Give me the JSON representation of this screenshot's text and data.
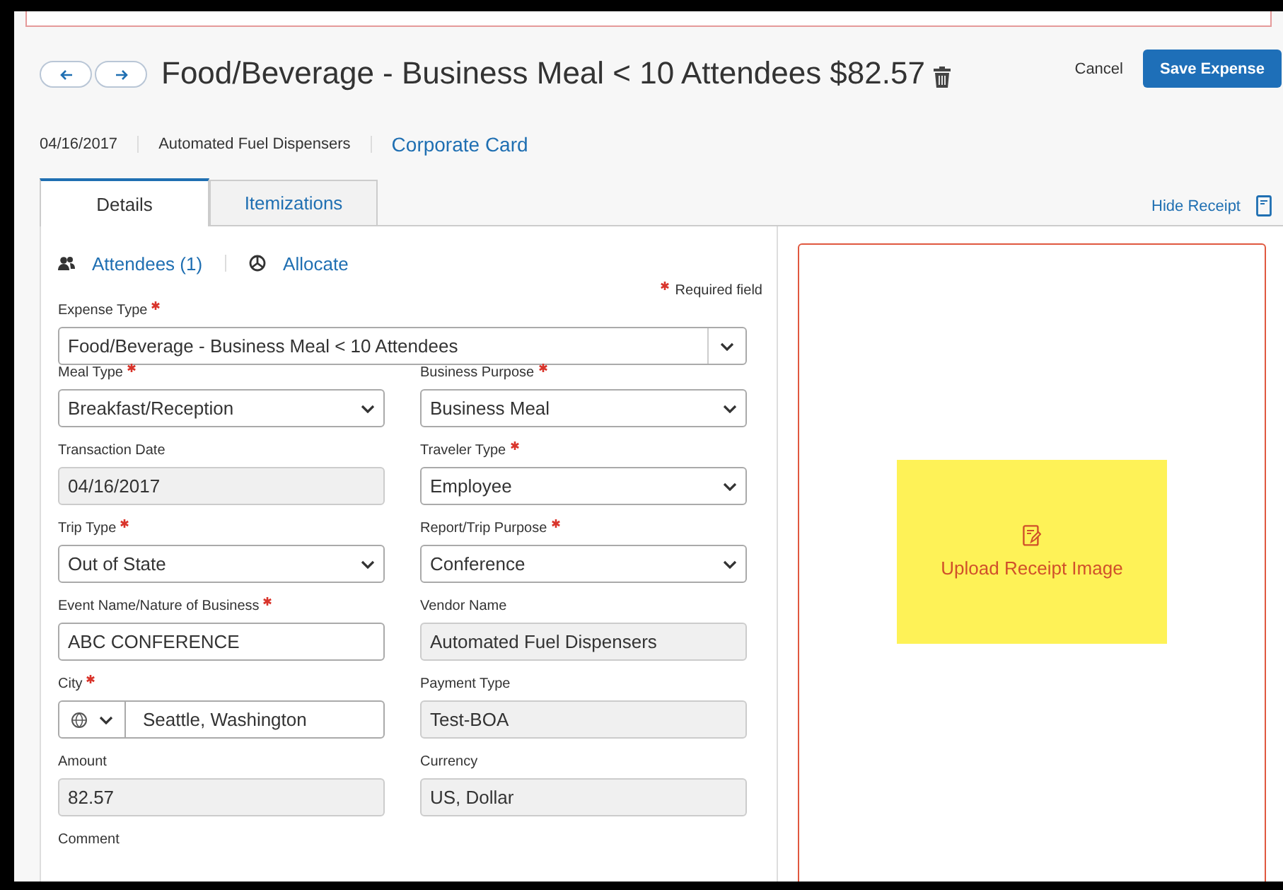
{
  "header": {
    "title": "Food/Beverage - Business Meal < 10 Attendees $82.57",
    "cancel": "Cancel",
    "save": "Save Expense"
  },
  "meta": {
    "date": "04/16/2017",
    "vendor": "Automated Fuel Dispensers",
    "payment": "Corporate Card"
  },
  "tabs": [
    {
      "label": "Details",
      "selected": true
    },
    {
      "label": "Itemizations",
      "selected": false
    }
  ],
  "hide_receipt": "Hide Receipt",
  "actions": [
    {
      "kind": "attendees",
      "label": "Attendees (1)"
    },
    {
      "kind": "allocate",
      "label": "Allocate"
    }
  ],
  "required_note": "Required field",
  "fields": [
    {
      "label": "Expense Type",
      "required": true,
      "kind": "wide_select",
      "value": "Food/Beverage - Business Meal < 10 Attendees"
    },
    {
      "label": "Meal Type",
      "required": true,
      "kind": "select",
      "value": "Breakfast/Reception"
    },
    {
      "label": "Business Purpose",
      "required": true,
      "kind": "select",
      "value": "Business Meal"
    },
    {
      "label": "Transaction Date",
      "required": false,
      "kind": "readonly",
      "value": "04/16/2017"
    },
    {
      "label": "Traveler Type",
      "required": true,
      "kind": "select",
      "value": "Employee"
    },
    {
      "label": "Trip Type",
      "required": true,
      "kind": "select",
      "value": "Out of State"
    },
    {
      "label": "Report/Trip Purpose",
      "required": true,
      "kind": "select",
      "value": "Conference"
    },
    {
      "label": "Event Name/Nature of Business",
      "required": true,
      "kind": "text",
      "value": "ABC CONFERENCE"
    },
    {
      "label": "Vendor Name",
      "required": false,
      "kind": "readonly",
      "value": "Automated Fuel Dispensers"
    },
    {
      "label": "City",
      "required": true,
      "kind": "city",
      "value": "Seattle, Washington"
    },
    {
      "label": "Payment Type",
      "required": false,
      "kind": "readonly",
      "value": "Test-BOA"
    },
    {
      "label": "Amount",
      "required": false,
      "kind": "readonly",
      "value": "82.57"
    },
    {
      "label": "Currency",
      "required": false,
      "kind": "readonly",
      "value": "US, Dollar"
    },
    {
      "label": "Comment",
      "required": false,
      "kind": "label_only"
    }
  ],
  "receipt": {
    "upload": "Upload Receipt Image"
  }
}
